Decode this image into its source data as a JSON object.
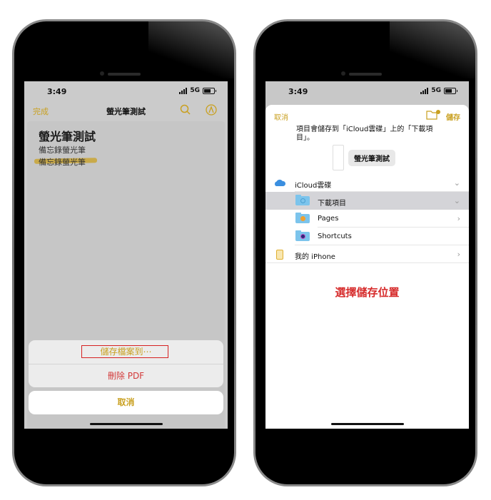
{
  "status": {
    "time": "3:49",
    "network": "5G"
  },
  "left": {
    "nav": {
      "done": "完成",
      "title": "螢光筆測試",
      "search_icon": "search-icon",
      "markup_icon": "markup-pen-icon"
    },
    "note": {
      "title": "螢光筆測試",
      "line1": "備忘錄螢光筆",
      "line2": "備忘錄螢光筆"
    },
    "sheet": {
      "save_to_files": "儲存檔案到⋯",
      "delete_pdf": "刪除 PDF",
      "cancel": "取消"
    },
    "colors": {
      "accent": "#c9a020",
      "destructive": "#d33a3a",
      "annotation_box": "#d62020"
    }
  },
  "right": {
    "picker": {
      "cancel": "取消",
      "save": "儲存",
      "new_folder_icon": "new-folder-icon",
      "message": "項目會儲存到「iCloud雲碟」上的「下載項目」。",
      "file_name": "螢光筆測試"
    },
    "locations": [
      {
        "label": "iCloud雲碟",
        "icon": "icloud-icon",
        "chevron": "down",
        "level": 0,
        "selected": false
      },
      {
        "label": "下載項目",
        "icon": "downloads-folder-icon",
        "chevron": "down",
        "level": 1,
        "selected": true
      },
      {
        "label": "Pages",
        "icon": "pages-folder-icon",
        "chevron": "right",
        "level": 1,
        "selected": false
      },
      {
        "label": "Shortcuts",
        "icon": "shortcuts-folder-icon",
        "chevron": "",
        "level": 1,
        "selected": false
      },
      {
        "label": "我的 iPhone",
        "icon": "iphone-icon",
        "chevron": "right",
        "level": 0,
        "selected": false
      }
    ],
    "caption": "選擇儲存位置",
    "colors": {
      "accent": "#c9a020",
      "caption": "#d62b2b",
      "folder": "#7cc4ec"
    }
  }
}
